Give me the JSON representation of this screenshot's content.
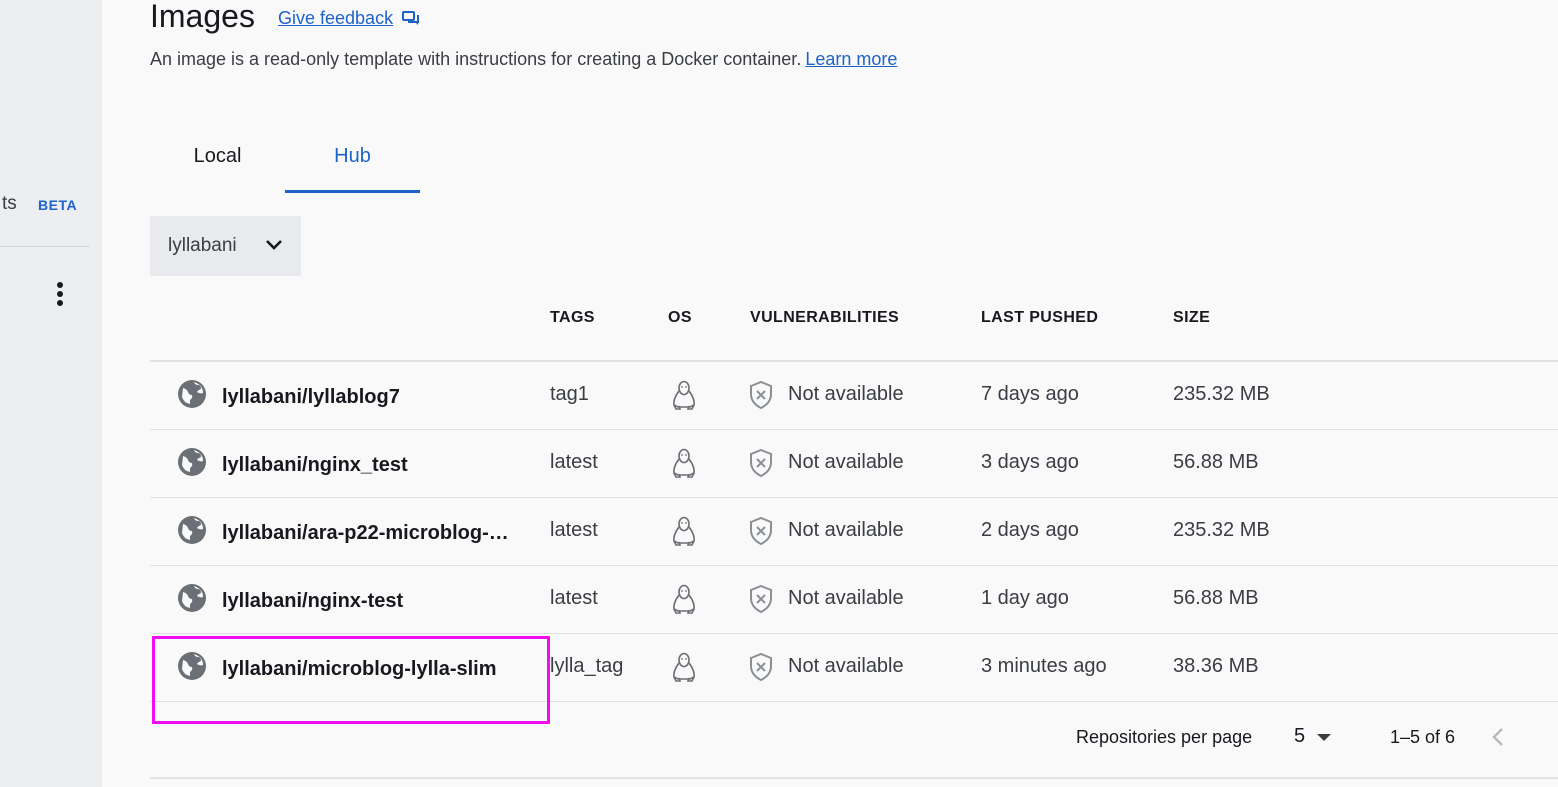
{
  "sidebar": {
    "partial_label": "ts",
    "beta_badge": "BETA"
  },
  "header": {
    "title": "Images",
    "feedback_link": "Give feedback",
    "description": "An image is a read-only template with instructions for creating a Docker container.",
    "learn_more": "Learn more"
  },
  "tabs": [
    {
      "label": "Local",
      "active": false
    },
    {
      "label": "Hub",
      "active": true
    }
  ],
  "namespace_select": {
    "value": "lyllabani"
  },
  "table": {
    "columns": [
      "TAGS",
      "OS",
      "VULNERABILITIES",
      "LAST PUSHED",
      "SIZE"
    ],
    "rows": [
      {
        "name": "lyllabani/lyllablog7",
        "tag": "tag1",
        "os_icon": "linux-icon",
        "vulnerabilities": "Not available",
        "last_pushed": "7 days ago",
        "size": "235.32 MB"
      },
      {
        "name": "lyllabani/nginx_test",
        "tag": "latest",
        "os_icon": "linux-icon",
        "vulnerabilities": "Not available",
        "last_pushed": "3 days ago",
        "size": "56.88 MB"
      },
      {
        "name": "lyllabani/ara-p22-microblog-…",
        "tag": "latest",
        "os_icon": "linux-icon",
        "vulnerabilities": "Not available",
        "last_pushed": "2 days ago",
        "size": "235.32 MB"
      },
      {
        "name": "lyllabani/nginx-test",
        "tag": "latest",
        "os_icon": "linux-icon",
        "vulnerabilities": "Not available",
        "last_pushed": "1 day ago",
        "size": "56.88 MB"
      },
      {
        "name": "lyllabani/microblog-lylla-slim",
        "tag": "lylla_tag",
        "os_icon": "linux-icon",
        "vulnerabilities": "Not available",
        "last_pushed": "3 minutes ago",
        "size": "38.36 MB"
      }
    ]
  },
  "pagination": {
    "per_page_label": "Repositories per page",
    "per_page_value": "5",
    "range": "1–5 of 6"
  },
  "colors": {
    "accent": "#1d63c8",
    "highlight": "#f20cf2"
  }
}
